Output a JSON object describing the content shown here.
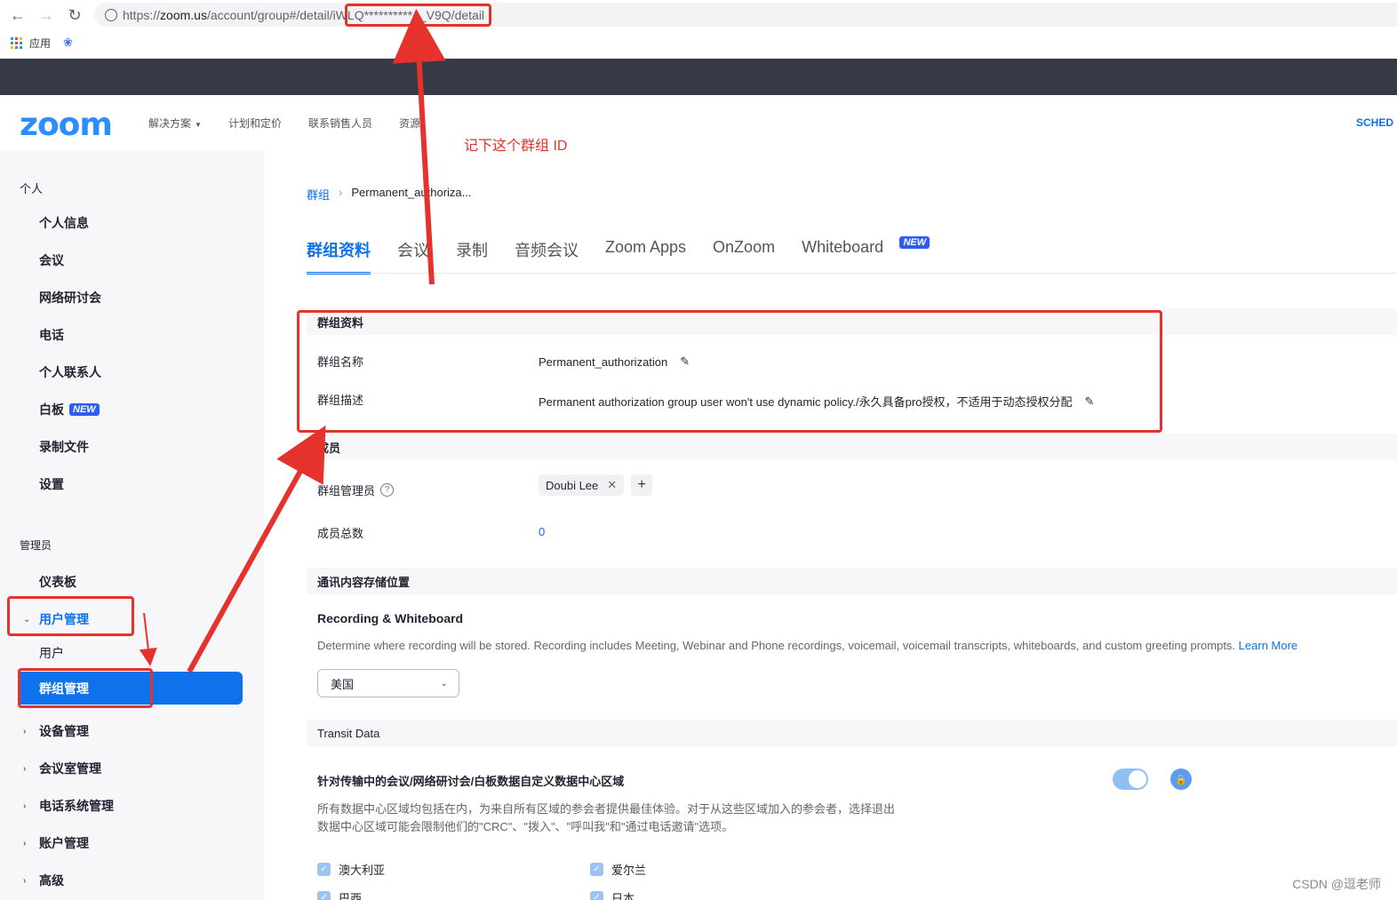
{
  "browser": {
    "url_prefix": "https://",
    "url_host": "zoom.us",
    "url_path": "/account/group#/detail/iWLQ**********4_V9Q/detail",
    "bookmark_apps": "应用"
  },
  "header": {
    "logo": "zoom",
    "nav": [
      "解决方案",
      "计划和定价",
      "联系销售人员",
      "资源"
    ],
    "schedule": "SCHED"
  },
  "annotation": {
    "note": "记下这个群组 ID"
  },
  "sidebar": {
    "personal_title": "个人",
    "personal_items": [
      "个人信息",
      "会议",
      "网络研讨会",
      "电话",
      "个人联系人",
      "白板",
      "录制文件",
      "设置"
    ],
    "whiteboard_badge": "NEW",
    "admin_title": "管理员",
    "dashboard": "仪表板",
    "user_mgmt": "用户管理",
    "users": "用户",
    "group_mgmt": "群组管理",
    "admin_items": [
      "设备管理",
      "会议室管理",
      "电话系统管理",
      "账户管理",
      "高级"
    ]
  },
  "main": {
    "breadcrumb": {
      "root": "群组",
      "current": "Permanent_authoriza..."
    },
    "tabs": [
      "群组资料",
      "会议",
      "录制",
      "音频会议",
      "Zoom Apps",
      "OnZoom",
      "Whiteboard"
    ],
    "tab_new_badge": "NEW",
    "profile": {
      "header": "群组资料",
      "name_label": "群组名称",
      "name_value": "Permanent_authorization",
      "desc_label": "群组描述",
      "desc_value": "Permanent authorization group user won't use dynamic policy./永久具备pro授权，不适用于动态授权分配"
    },
    "members": {
      "header": "成员",
      "admin_label": "群组管理员",
      "admin_value": "Doubi Lee",
      "total_label": "成员总数",
      "total_value": "0"
    },
    "storage": {
      "header": "通讯内容存储位置",
      "title": "Recording & Whiteboard",
      "desc": "Determine where recording will be stored. Recording includes Meeting, Webinar and Phone recordings, voicemail, voicemail transcripts, whiteboards, and custom greeting prompts.",
      "learn_more": "Learn More",
      "region": "美国"
    },
    "transit": {
      "header": "Transit Data",
      "title": "针对传输中的会议/网络研讨会/白板数据自定义数据中心区域",
      "desc1": "所有数据中心区域均包括在内，为来自所有区域的参会者提供最佳体验。对于从这些区域加入的参会者，选择退出",
      "desc2": "数据中心区域可能会限制他们的\"CRC\"、\"拨入\"、\"呼叫我\"和\"通过电话邀请\"选项。",
      "regions": [
        "澳大利亚",
        "爱尔兰",
        "巴西",
        "日本"
      ]
    }
  },
  "watermark": "CSDN @逗老师",
  "colors": {
    "accent": "#0e72ed",
    "annotation": "#e5322d",
    "sidebar_bg": "#f7f7fa"
  }
}
